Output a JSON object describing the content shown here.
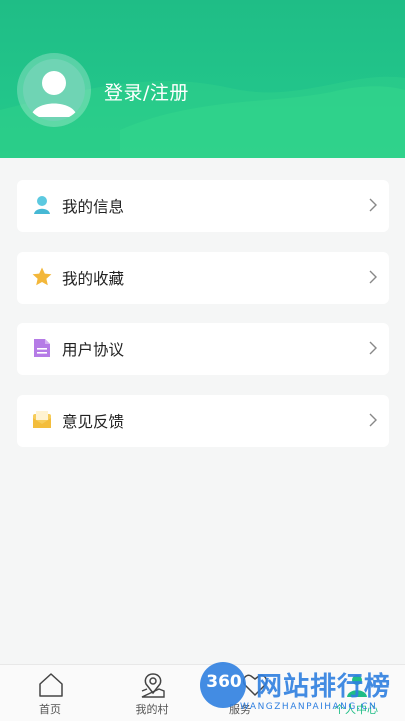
{
  "profile": {
    "login_label": "登录/注册"
  },
  "menu": [
    {
      "label": "我的信息",
      "icon": "user-icon",
      "color": "#5cc9e0"
    },
    {
      "label": "我的收藏",
      "icon": "star-icon",
      "color": "#f3b73a"
    },
    {
      "label": "用户协议",
      "icon": "document-icon",
      "color": "#b57be6"
    },
    {
      "label": "意见反馈",
      "icon": "mail-icon",
      "color": "#f6cc5a"
    }
  ],
  "tabbar": {
    "items": [
      {
        "label": "首页",
        "icon": "home-icon"
      },
      {
        "label": "我的村",
        "icon": "map-pin-icon"
      },
      {
        "label": "服务",
        "icon": "heart-icon"
      },
      {
        "label": "个人中心",
        "icon": "person-icon"
      }
    ]
  },
  "watermark": {
    "number": "360",
    "title": "网站排行榜",
    "domain": "WANGZHANPAIHANG.CN"
  },
  "colors": {
    "brand_green": "#1fbd86",
    "background": "#f5f6f6"
  }
}
